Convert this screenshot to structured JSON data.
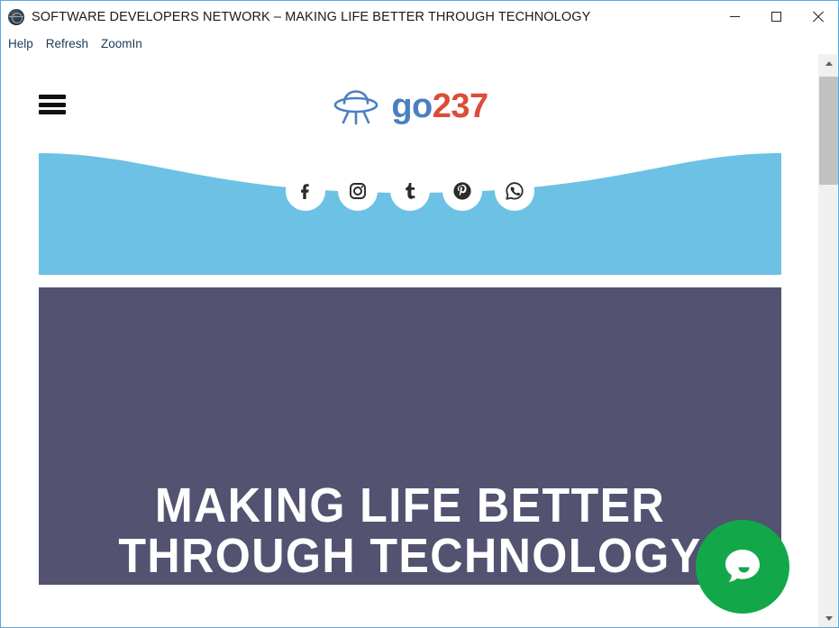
{
  "window": {
    "title": "SOFTWARE DEVELOPERS NETWORK – MAKING LIFE BETTER THROUGH TECHNOLOGY",
    "icon": "app-logo-icon",
    "controls": {
      "minimize": "minimize-icon",
      "maximize": "maximize-icon",
      "close": "close-icon"
    }
  },
  "menubar": {
    "items": [
      {
        "label": "Help"
      },
      {
        "label": "Refresh"
      },
      {
        "label": "ZoomIn"
      }
    ]
  },
  "page": {
    "header": {
      "menu_icon": "hamburger-menu-icon",
      "logo_icon": "ufo-icon",
      "brand_primary": "go",
      "brand_accent": "237"
    },
    "social": {
      "band_color": "#6cc1e4",
      "items": [
        {
          "name": "facebook",
          "label": "Facebook"
        },
        {
          "name": "instagram",
          "label": "Instagram"
        },
        {
          "name": "tumblr",
          "label": "Tumblr"
        },
        {
          "name": "pinterest",
          "label": "Pinterest"
        },
        {
          "name": "whatsapp",
          "label": "WhatsApp"
        }
      ]
    },
    "hero": {
      "background_color": "#535270",
      "heading": "MAKING LIFE BETTER\nTHROUGH TECHNOLOGY"
    },
    "chat": {
      "icon": "chat-bubble-icon",
      "color": "#12a84a"
    }
  },
  "colors": {
    "brand_blue": "#4a7fc1",
    "brand_red": "#dd4b39",
    "band_blue": "#6cc1e4",
    "hero_slate": "#535270",
    "chat_green": "#12a84a"
  }
}
